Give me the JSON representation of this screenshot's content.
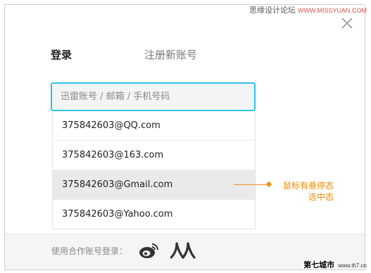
{
  "watermark_top": {
    "cn": "思缘设计论坛",
    "en": "WWW.MISSYUAN.COM"
  },
  "tabs": {
    "login": "登录",
    "register": "注册新账号"
  },
  "login": {
    "placeholder": "迅雷账号 / 邮箱 / 手机号码",
    "suggestions": [
      "375842603@QQ.com",
      "375842603@163.com",
      "375842603@Gmail.com",
      "375842603@Yahoo.com"
    ],
    "hovered_index": 2
  },
  "annotation": {
    "line1": "鼠标有悬停态",
    "line2": "选中态"
  },
  "footer": {
    "label": "使用合作账号登录："
  },
  "icons": {
    "close": "close-icon",
    "weibo": "weibo-icon",
    "renren": "renren-icon"
  },
  "colors": {
    "accent": "#2cc3e8",
    "annotation": "#f08a00",
    "hover_bg": "#eaeaea"
  },
  "watermark_bottom": {
    "cn": "第七城市",
    "en": "www.th7.cn"
  }
}
